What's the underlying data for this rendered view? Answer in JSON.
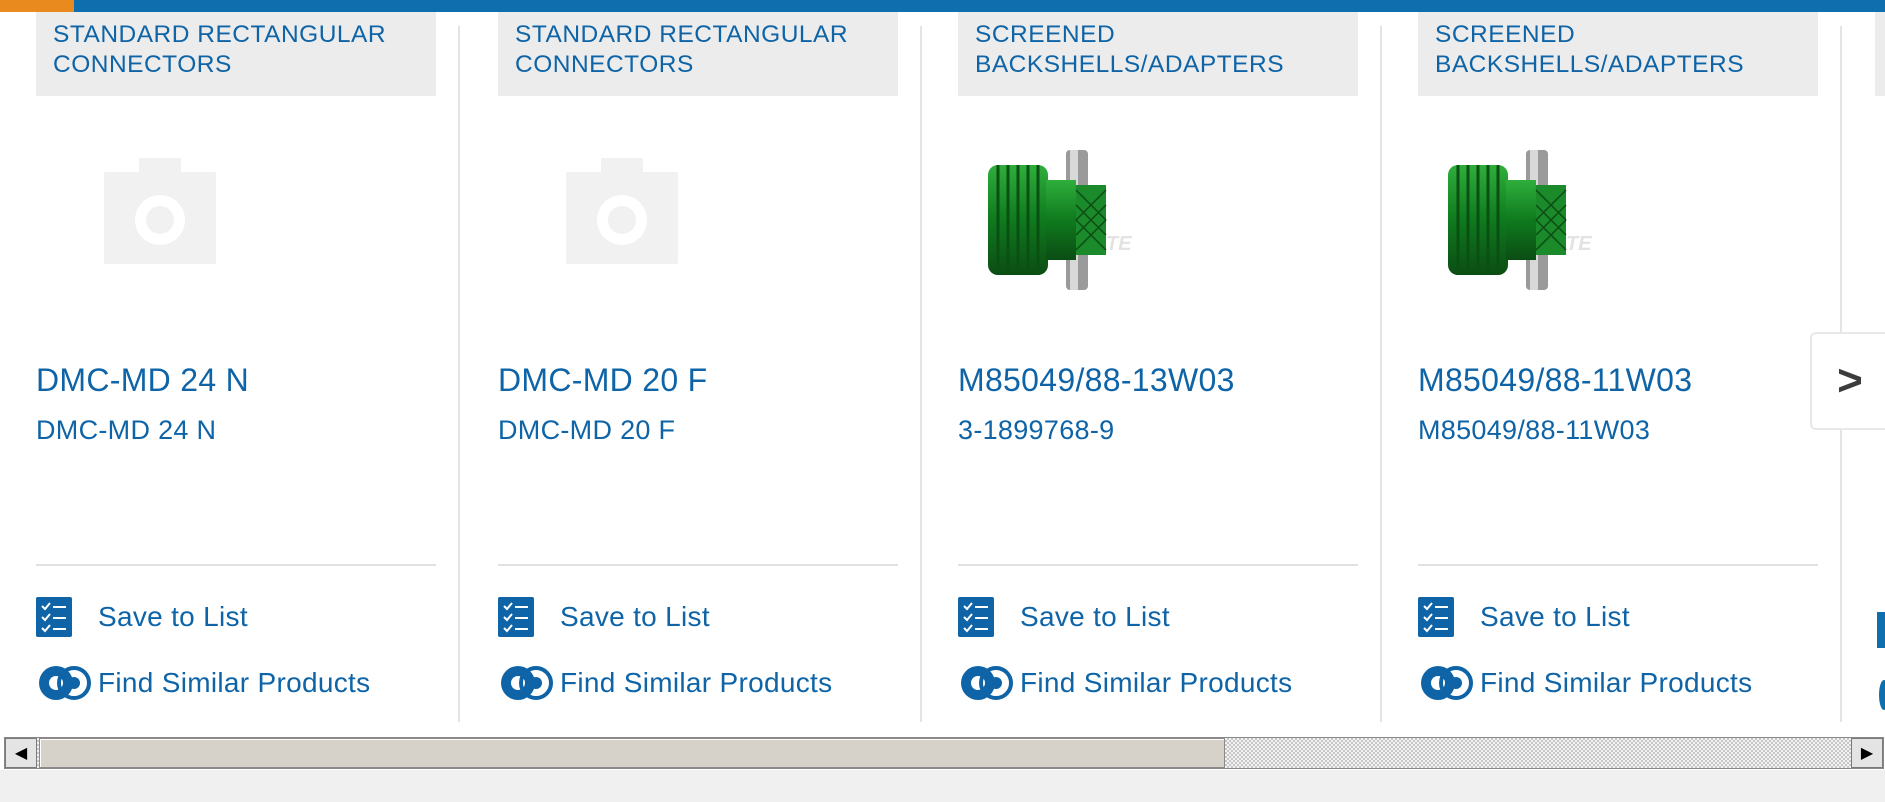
{
  "colors": {
    "brand_blue": "#0e64a6",
    "accent_orange": "#e88a1d",
    "topbar_blue": "#0f6eae"
  },
  "cards": [
    {
      "category": [
        "STANDARD RECTANGULAR",
        "CONNECTORS"
      ],
      "image": "placeholder-camera-icon",
      "title": "DMC-MD 24 N",
      "subtitle": "DMC-MD 24 N",
      "save_label": "Save to List",
      "similar_label": "Find Similar Products"
    },
    {
      "category": [
        "STANDARD RECTANGULAR",
        "CONNECTORS"
      ],
      "image": "placeholder-camera-icon",
      "title": "DMC-MD 20 F",
      "subtitle": "DMC-MD 20 F",
      "save_label": "Save to List",
      "similar_label": "Find Similar Products"
    },
    {
      "category": [
        "SCREENED",
        "BACKSHELLS/ADAPTERS"
      ],
      "image": "green-backshell-product-image",
      "title": "M85049/88-13W03",
      "subtitle": "3-1899768-9",
      "save_label": "Save to List",
      "similar_label": "Find Similar Products"
    },
    {
      "category": [
        "SCREENED",
        "BACKSHELLS/ADAPTERS"
      ],
      "image": "green-backshell-product-image",
      "title": "M85049/88-11W03",
      "subtitle": "M85049/88-11W03",
      "save_label": "Save to List",
      "similar_label": "Find Similar Products"
    }
  ],
  "carousel": {
    "next_icon": "chevron-right-icon",
    "next_glyph": ">"
  },
  "scrollbar": {
    "left_glyph": "◀",
    "right_glyph": "▶"
  }
}
